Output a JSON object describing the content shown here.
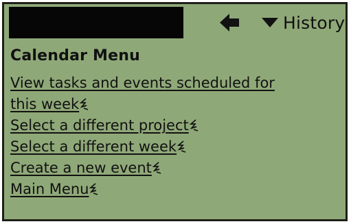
{
  "header": {
    "history_label": "History"
  },
  "icons": {
    "back": "arrow-left-icon",
    "history_dropdown": "triangle-down-icon",
    "link_marker": "link-ear-icon"
  },
  "main": {
    "title": "Calendar  Menu",
    "links": [
      {
        "line1": "View tasks and events scheduled for",
        "line2": "this week"
      },
      {
        "text": "Select a different project"
      },
      {
        "text": "Select a different week"
      },
      {
        "text": "Create a new event"
      },
      {
        "text": "Main Menu"
      }
    ]
  },
  "colors": {
    "screen_background": "#8fa878",
    "text": "#111111",
    "title_redaction": "#060606"
  }
}
